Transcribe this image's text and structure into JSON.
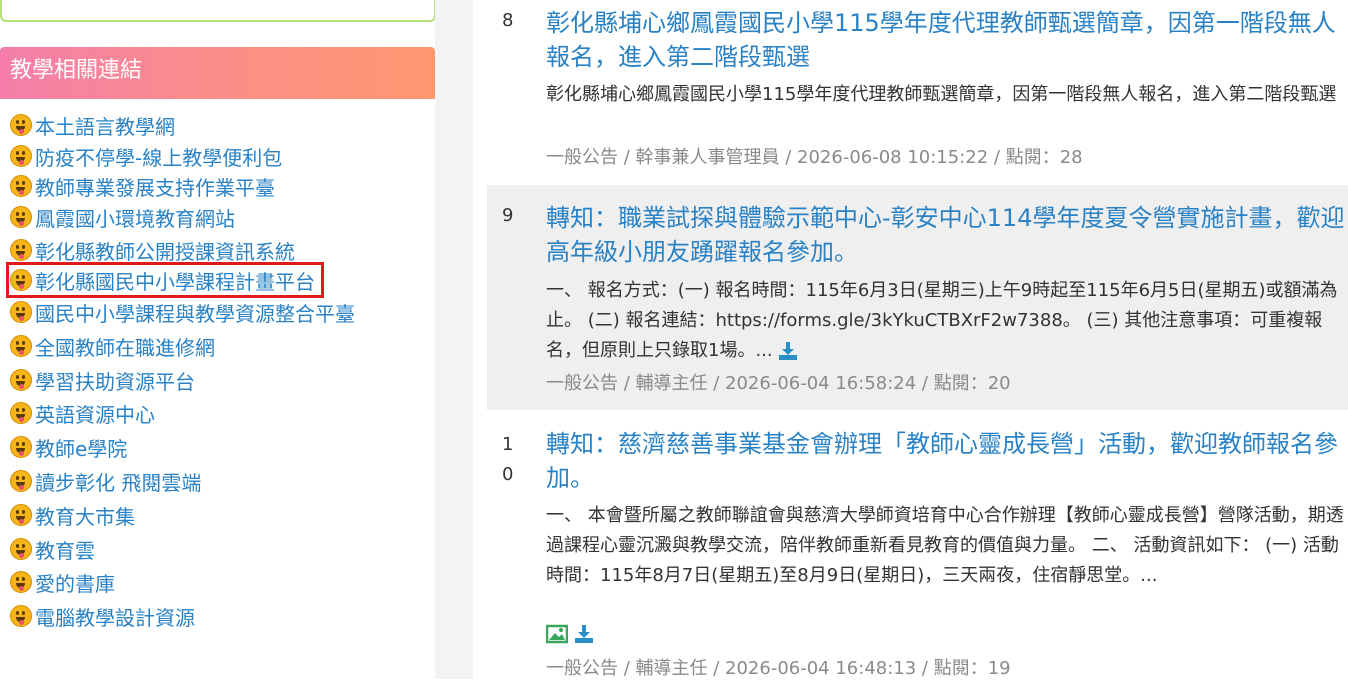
{
  "sidebar": {
    "panel_title": "教學相關連結",
    "links": [
      {
        "label": "本土語言教學網"
      },
      {
        "label": "防疫不停學-線上教學便利包"
      },
      {
        "label": "教師專業發展支持作業平臺"
      },
      {
        "label": "鳳霞國小環境教育網站"
      },
      {
        "label": "彰化縣教師公開授課資訊系統"
      },
      {
        "label": "彰化縣國民中小學課程計畫平台"
      },
      {
        "label": "國民中小學課程與教學資源整合平臺"
      },
      {
        "label": "全國教師在職進修網"
      },
      {
        "label": "學習扶助資源平台"
      },
      {
        "label": "英語資源中心"
      },
      {
        "label": "教師e學院"
      },
      {
        "label": "讀步彰化 飛閱雲端"
      },
      {
        "label": "教育大市集"
      },
      {
        "label": "教育雲"
      },
      {
        "label": "愛的書庫"
      },
      {
        "label": "電腦教學設計資源"
      }
    ]
  },
  "posts": [
    {
      "number": "8",
      "title": "彰化縣埔心鄉鳳霞國民小學115學年度代理教師甄選簡章，因第一階段無人報名，進入第二階段甄選",
      "summary": "彰化縣埔心鄉鳳霞國民小學115學年度代理教師甄選簡章，因第一階段無人報名，進入第二階段甄選",
      "meta": "一般公告 / 幹事兼人事管理員 / 2026-06-08 10:15:22 / 點閱：28"
    },
    {
      "number": "9",
      "title": "轉知：職業試探與體驗示範中心-彰安中心114學年度夏令營實施計畫，歡迎高年級小朋友踴躍報名參加。",
      "summary": "一、 報名方式：(一) 報名時間：115年6月3日(星期三)上午9時起至115年6月5日(星期五)或額滿為止。 (二) 報名連結：https://forms.gle/3kYkuCTBXrF2w7388。 (三) 其他注意事項：可重複報名，但原則上只錄取1場。...",
      "meta": "一般公告 / 輔導主任 / 2026-06-04 16:58:24 / 點閱：20"
    },
    {
      "number": "1\n0",
      "title": "轉知：慈濟慈善事業基金會辦理「教師心靈成長營」活動，歡迎教師報名參加。",
      "summary": "一、 本會暨所屬之教師聯誼會與慈濟大學師資培育中心合作辦理【教師心靈成長營】營隊活動，期透過課程心靈沉澱與教學交流，陪伴教師重新看見教育的價值與力量。 二、 活動資訊如下： (一) 活動時間：115年8月7日(星期五)至8月9日(星期日)，三天兩夜，住宿靜思堂。...",
      "meta": "一般公告 / 輔導主任 / 2026-06-04 16:48:13 / 點閱：19"
    }
  ],
  "colors": {
    "link": "#2a82c6",
    "highlight": "#e01919",
    "header_start": "#f67eaa",
    "header_end": "#fd9870",
    "download_icon": "#2a8fc6",
    "image_icon": "#3aa55c"
  },
  "icons": [
    "smiley-tongue-icon",
    "download-icon",
    "image-icon"
  ]
}
